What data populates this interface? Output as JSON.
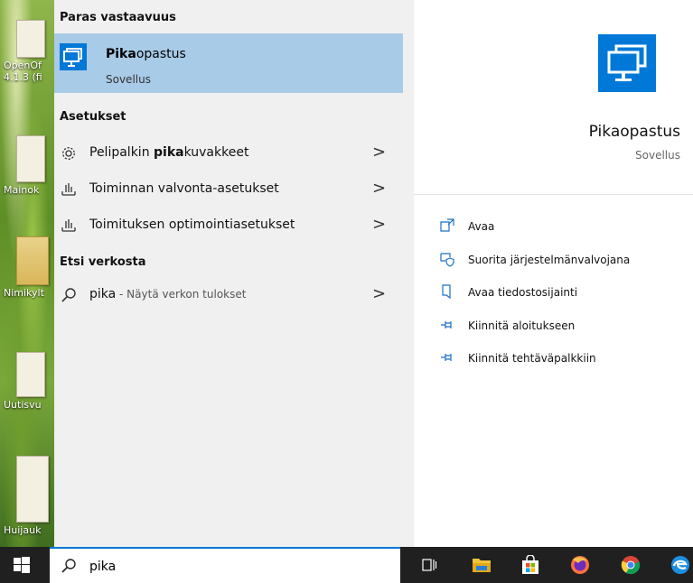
{
  "desktop": {
    "icons": [
      {
        "label": "OpenOf"
      },
      {
        "label": "4.1.3 (fi"
      },
      {
        "label": "Mainok"
      },
      {
        "label": "Nimikylt"
      },
      {
        "label": "Uutisvu"
      },
      {
        "label": "Huijauk"
      }
    ]
  },
  "search": {
    "best_match_heading": "Paras vastaavuus",
    "best_match": {
      "name_bold": "Pika",
      "name_rest": "opastus",
      "type": "Sovellus"
    },
    "settings_heading": "Asetukset",
    "settings": [
      {
        "icon": "gear-icon",
        "prefix": "Pelipalkin ",
        "bold": "pika",
        "suffix": "kuvakkeet",
        "chevron": ">"
      },
      {
        "icon": "tray-chart-icon",
        "prefix": "Toiminnan valvonta-asetukset",
        "bold": "",
        "suffix": "",
        "chevron": ">"
      },
      {
        "icon": "tray-chart-icon",
        "prefix": "Toimituksen optimointiasetukset",
        "bold": "",
        "suffix": "",
        "chevron": ">"
      }
    ],
    "web_heading": "Etsi verkosta",
    "web": {
      "query": "pika",
      "sub": " - Näytä verkon tulokset",
      "chevron": ">"
    }
  },
  "details": {
    "name": "Pikaopastus",
    "type": "Sovellus",
    "actions": [
      {
        "label": "Avaa"
      },
      {
        "label": "Suorita järjestelmänvalvojana"
      },
      {
        "label": "Avaa tiedostosijainti"
      },
      {
        "label": "Kiinnitä aloitukseen"
      },
      {
        "label": "Kiinnitä tehtäväpalkkiin"
      }
    ]
  },
  "taskbar": {
    "search_value": "pika"
  },
  "colors": {
    "accent": "#0078d7",
    "highlight": "#a8cbe8",
    "taskbar": "#202020"
  }
}
